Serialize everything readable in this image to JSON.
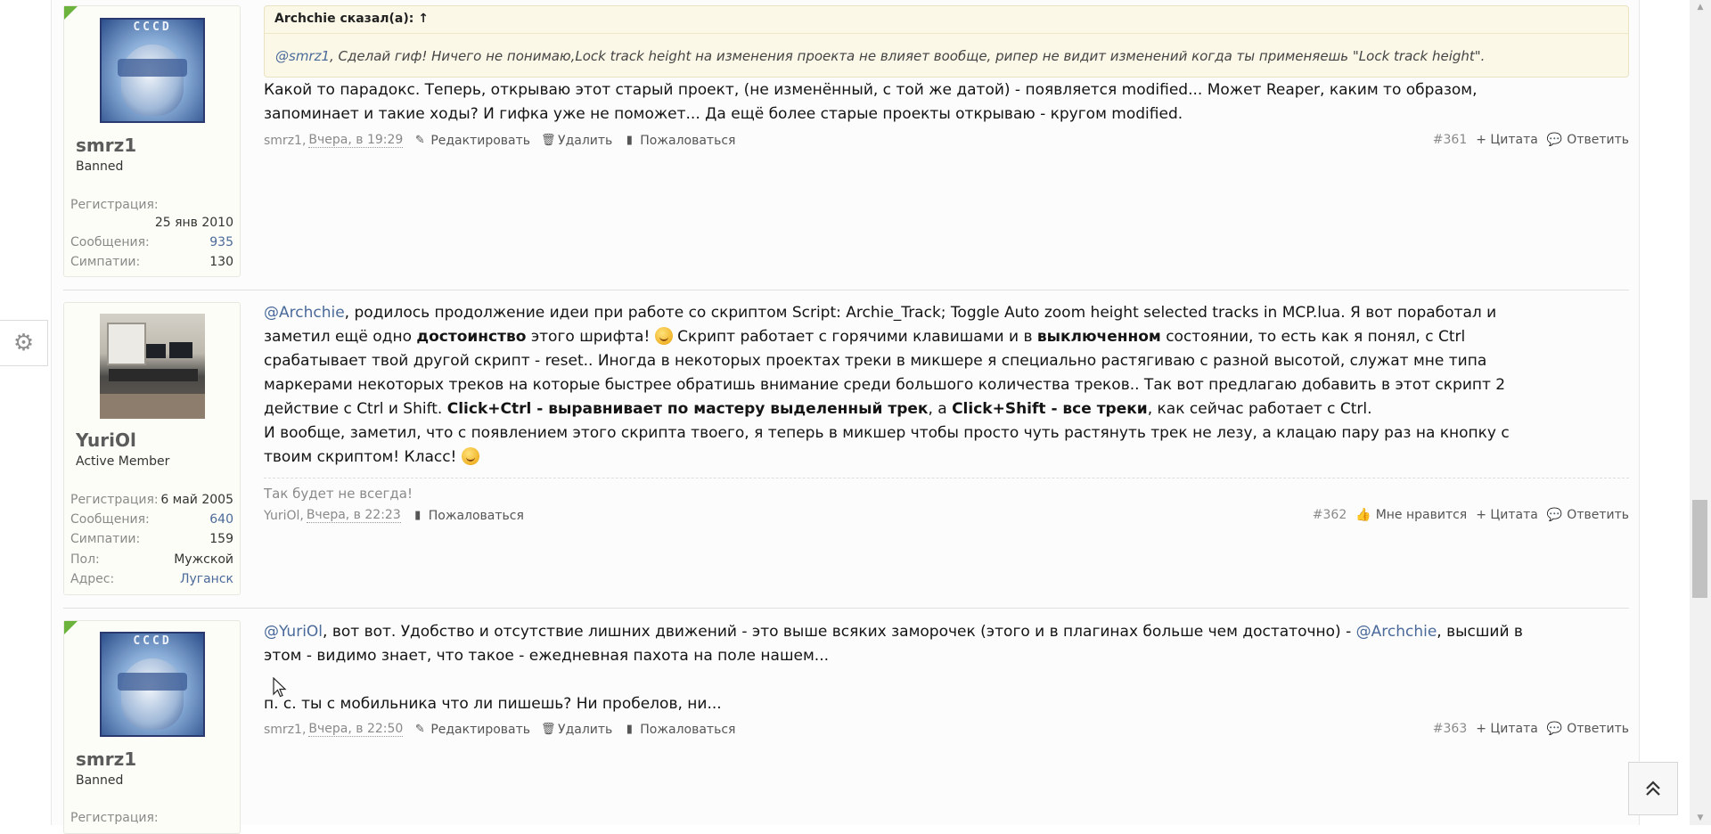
{
  "posts": [
    {
      "user": {
        "name": "smrz1",
        "title": "Banned",
        "reg_label": "Регистрация:",
        "reg_value": "25 янв 2010",
        "msg_label": "Сообщения:",
        "msg_value": "935",
        "likes_label": "Симпатии:",
        "likes_value": "130"
      },
      "quote": {
        "header": "Archchie сказал(а): ↑",
        "mention": "@smrz1",
        "text": ", Сделай гиф! Ничего не понимаю,Lock track height на изменения проекта не влияет вообще, рипер не видит изменений когда ты применяешь \"Lock track height\"."
      },
      "lines": [
        "Какой то парадокс. Теперь, открываю этот старый проект, (не изменённый, с той же датой) - появляется modified... Может Reaper, каким то образом,",
        "запоминает и такие ходы? И гифка уже не поможет... Да ещё более старые проекты открываю - кругом modified."
      ],
      "meta": {
        "author": "smrz1,",
        "date": "Вчера, в 19:29",
        "edit": "Редактировать",
        "delete": "Удалить",
        "report": "Пожаловаться",
        "number": "#361",
        "quote": "+ Цитата",
        "reply": "Ответить"
      }
    },
    {
      "user": {
        "name": "YuriOl",
        "title": "Active Member",
        "reg_label": "Регистрация:",
        "reg_value": "6 май 2005",
        "msg_label": "Сообщения:",
        "msg_value": "640",
        "likes_label": "Симпатии:",
        "likes_value": "159",
        "gender_label": "Пол:",
        "gender_value": "Мужской",
        "address_label": "Адрес:",
        "address_value": "Луганск"
      },
      "text": {
        "l1_mention": "@Archchie",
        "l1_rest": ", родилось продолжение идеи при работе со скриптом Script: Archie_Track; Toggle Auto zoom height selected tracks in MCP.lua. Я вот поработал и",
        "l2_a": "заметил ещё одно ",
        "l2_b": "достоинство",
        "l2_c": " этого шрифта! ",
        "l2_d": " Скрипт работает с горячими клавишами и в ",
        "l2_e": "выключенном",
        "l2_f": " состоянии, то есть как я понял, с Ctrl",
        "l3": "срабатывает твой другой скрипт - reset.. Иногда в некоторых проектах треки в микшере я специально растягиваю с разной высотой, служат мне типа",
        "l4": "маркерами некоторых треков на которые быстрее обратишь внимание среди большого количества треков.. Так вот предлагаю добавить в этот скрипт 2",
        "l5_a": "действие с Ctrl и Shift. ",
        "l5_b": "Click+Ctrl - выравнивает по мастеру выделенный трек",
        "l5_c": ", а ",
        "l5_d": "Click+Shift - все треки",
        "l5_e": ", как сейчас работает с Ctrl.",
        "l6": "И вообще, заметил, что с появлением этого скрипта твоего, я теперь в микшер чтобы просто чуть растянуть трек не лезу, а клацаю пару раз на кнопку с",
        "l7": "твоим скриптом! Класс! "
      },
      "signature": "Так будет не всегда!",
      "meta": {
        "author": "YuriOl,",
        "date": "Вчера, в 22:23",
        "report": "Пожаловаться",
        "number": "#362",
        "like": "Мне нравится",
        "quote": "+ Цитата",
        "reply": "Ответить"
      }
    },
    {
      "user": {
        "name": "smrz1",
        "title": "Banned",
        "reg_label": "Регистрация:"
      },
      "text": {
        "l1_mention": "@YuriOl",
        "l1_mid": ", вот вот. Удобство и отсутствие лишних движений - это выше всяких заморочек (этого и в плагинах больше чем достаточно) - ",
        "l1_mention2": "@Archchie",
        "l1_end": ", высший в",
        "l2": "этом - видимо знает, что такое - ежедневная пахота на поле нашем...",
        "l3": "п. с. ты с мобильника что ли пишешь? Ни пробелов, ни..."
      },
      "meta": {
        "author": "smrz1,",
        "date": "Вчера, в 22:50",
        "edit": "Редактировать",
        "delete": "Удалить",
        "report": "Пожаловаться",
        "number": "#363",
        "quote": "+ Цитата",
        "reply": "Ответить"
      }
    }
  ],
  "avatar_text": "CCCD",
  "icons": {
    "gear": "gear-icon",
    "back_to_top": "double-chevron-up-icon",
    "edit": "pencil-icon",
    "delete": "trash-icon",
    "report": "book-icon",
    "reply": "speech-bubble-icon",
    "like": "thumbs-up-icon"
  },
  "colors": {
    "link": "#4a6a9a",
    "quote_bg": "#fbf8e8",
    "banned_flag": "#6cb33e"
  }
}
